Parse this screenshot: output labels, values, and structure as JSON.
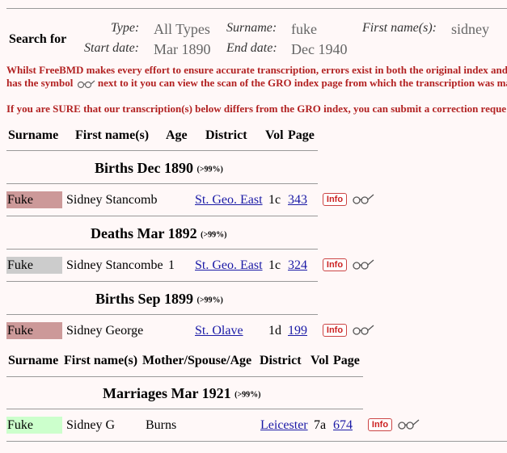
{
  "search": {
    "title": "Search for",
    "type_label": "Type:",
    "type_value": "All Types",
    "surname_label": "Surname:",
    "surname_value": "fuke",
    "firstnames_label": "First name(s):",
    "firstnames_value": "sidney",
    "start_label": "Start date:",
    "start_value": "Mar 1890",
    "end_label": "End date:",
    "end_value": "Dec 1940"
  },
  "notice": {
    "line1": "Whilst FreeBMD makes every effort to ensure accurate transcription, errors exist in both the original index and",
    "line2a": "has the symbol",
    "line2b": "next to it you can view the scan of the GRO index page from which the transcription was ma",
    "line3": "If you are SURE that our transcription(s) below differs from the GRO index, you can submit a correction reque"
  },
  "headers1": {
    "surname": "Surname",
    "first": "First name(s)",
    "age": "Age",
    "district": "District",
    "vol": "Vol",
    "page": "Page"
  },
  "headers2": {
    "surname": "Surname",
    "first": "First name(s)",
    "mother": "Mother/Spouse/Age",
    "district": "District",
    "vol": "Vol",
    "page": "Page"
  },
  "sections": [
    {
      "title": "Births Dec 1890",
      "pct": "(>99%)"
    },
    {
      "title": "Deaths Mar 1892",
      "pct": "(>99%)"
    },
    {
      "title": "Births Sep 1899",
      "pct": "(>99%)"
    },
    {
      "title": "Marriages Mar 1921",
      "pct": "(>99%)"
    }
  ],
  "rows": [
    {
      "surname": "Fuke",
      "first": "Sidney Stancomb",
      "age": "",
      "district": "St. Geo. East",
      "vol": "1c",
      "page": "343",
      "color": "#cc9999"
    },
    {
      "surname": "Fuke",
      "first": "Sidney Stancombe",
      "age": "1",
      "district": "St. Geo. East",
      "vol": "1c",
      "page": "324",
      "color": "#cccccc"
    },
    {
      "surname": "Fuke",
      "first": "Sidney George",
      "age": "",
      "district": "St. Olave",
      "vol": "1d",
      "page": "199",
      "color": "#cc9999"
    },
    {
      "surname": "Fuke",
      "first": "Sidney G",
      "mother": "Burns",
      "district": "Leicester",
      "vol": "7a",
      "page": "674",
      "color": "#ccffcc"
    }
  ],
  "icons": {
    "info_label": "Info",
    "scan": "glasses-scan-icon"
  }
}
